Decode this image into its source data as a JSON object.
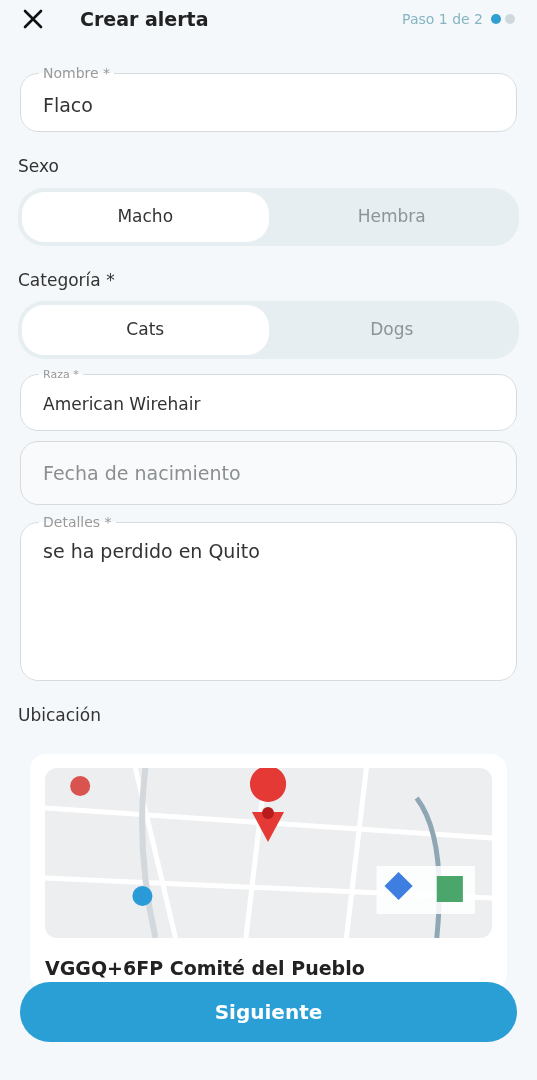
{
  "header": {
    "title": "Crear alerta",
    "step": "Paso 1 de 2",
    "steps": [
      {
        "selected": true
      },
      {
        "selected": false
      }
    ]
  },
  "form": [
    {
      "kind": "input",
      "label": "Nombre *",
      "value": "Flaco"
    },
    {
      "kind": "segmented",
      "label": "Sexo",
      "options": [
        {
          "label": "Macho",
          "selected": true
        },
        {
          "label": "Hembra",
          "selected": false
        }
      ]
    },
    {
      "kind": "segmented",
      "label": "Categoría *",
      "options": [
        {
          "label": "Cats",
          "selected": true
        },
        {
          "label": "Dogs",
          "selected": false
        }
      ]
    },
    {
      "kind": "input",
      "label": "Raza *",
      "value": "American Wirehair",
      "small": true
    },
    {
      "kind": "input",
      "placeholder": "Fecha de nacimiento"
    },
    {
      "kind": "textarea",
      "label": "Detalles *",
      "value": "se ha perdido en Quito"
    }
  ],
  "location": {
    "label": "Ubicación",
    "address": "VGGQ+6FP Comité del Pueblo"
  },
  "next_button": "Siguiente"
}
